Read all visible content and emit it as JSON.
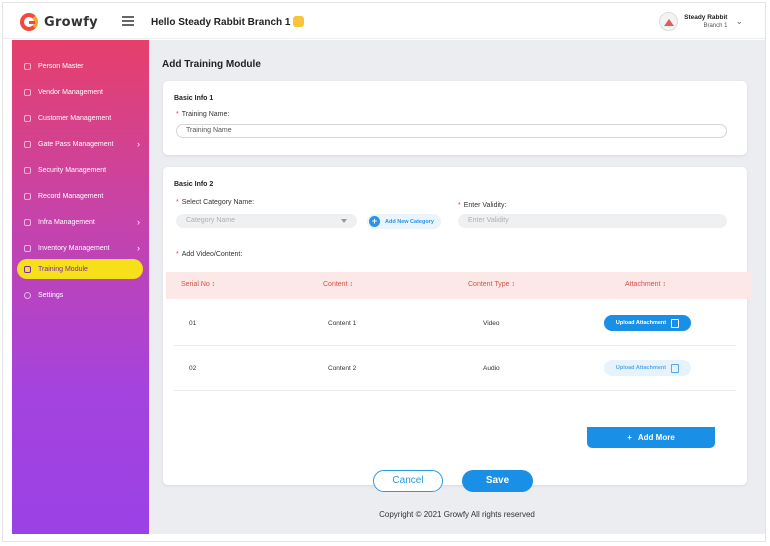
{
  "header": {
    "logo_text": "Growfy",
    "greeting": "Hello Steady Rabbit Branch 1",
    "user_name": "Steady Rabbit",
    "user_branch": "Branch 1"
  },
  "sidebar": {
    "items": [
      {
        "label": "Person Master",
        "icon": "person-icon",
        "arrow": false
      },
      {
        "label": "Vendor Management",
        "icon": "vendor-icon",
        "arrow": false
      },
      {
        "label": "Customer Management",
        "icon": "customer-icon",
        "arrow": false
      },
      {
        "label": "Gate Pass Management",
        "icon": "gate-pass-icon",
        "arrow": true
      },
      {
        "label": "Security Management",
        "icon": "security-icon",
        "arrow": false
      },
      {
        "label": "Record Management",
        "icon": "record-icon",
        "arrow": false
      },
      {
        "label": "Infra Management",
        "icon": "infra-icon",
        "arrow": true
      },
      {
        "label": "Inventory Management",
        "icon": "inventory-icon",
        "arrow": true
      },
      {
        "label": "Training Module",
        "icon": "training-icon",
        "arrow": false,
        "active": true
      },
      {
        "label": "Settings",
        "icon": "settings-icon",
        "arrow": false
      }
    ]
  },
  "main": {
    "page_title": "Add Training Module",
    "basic_info_1": {
      "title": "Basic Info 1",
      "training_name_label": "Training Name:",
      "training_name_placeholder": "Training Name"
    },
    "basic_info_2": {
      "title": "Basic Info 2",
      "category_label": "Select Category Name:",
      "category_placeholder": "Category Name",
      "add_category": "Add New Category",
      "validity_label": "Enter Validity:",
      "validity_placeholder": "Enter Validity",
      "video_label": "Add Video/Content:"
    },
    "table": {
      "headers": [
        "Serial No ↕",
        "Content ↕",
        "Content Type ↕",
        "Attachment ↕"
      ],
      "rows": [
        {
          "serial": "01",
          "content": "Content 1",
          "type": "Video",
          "attachment": "Upload Attachment",
          "active": true
        },
        {
          "serial": "02",
          "content": "Content 2",
          "type": "Audio",
          "attachment": "Upload Attachment",
          "active": false
        }
      ]
    },
    "add_more": "Add More",
    "cancel": "Cancel",
    "save": "Save",
    "footer": "Copyright © 2021 Growfy All rights reserved"
  },
  "colors": {
    "brand_red": "#ef4a3b",
    "primary_blue": "#1a8fe6",
    "active_nav_yellow": "#f5e01a",
    "table_header_bg": "#fce8e6"
  }
}
